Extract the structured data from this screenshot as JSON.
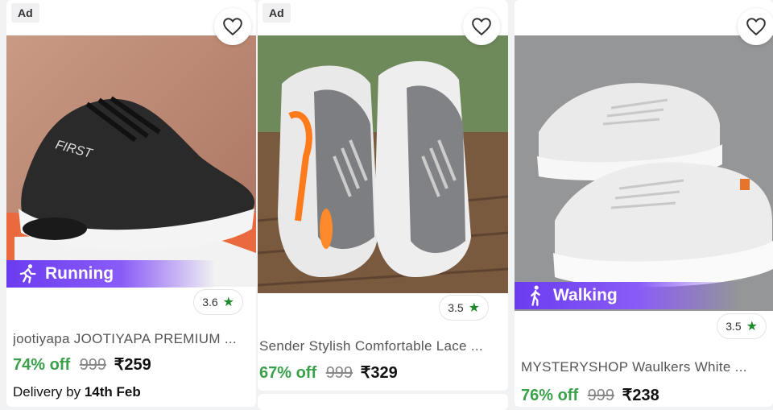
{
  "products": [
    {
      "ad": "Ad",
      "tag": "Running",
      "rating": "3.6",
      "title": "jootiyapa JOOTIYAPA PREMIUM ...",
      "discount": "74% off",
      "mrp": "999",
      "price": "₹259",
      "delivery_prefix": "Delivery by",
      "delivery_date": "14th Feb"
    },
    {
      "ad": "Ad",
      "rating": "3.5",
      "title": "Sender Stylish Comfortable Lace ...",
      "discount": "67% off",
      "mrp": "999",
      "price": "₹329"
    },
    {
      "tag": "Walking",
      "rating": "3.5",
      "title": "MYSTERYSHOP Waulkers White ...",
      "discount": "76% off",
      "mrp": "999",
      "price": "₹238"
    }
  ],
  "icons": {
    "wishlist": "heart-icon",
    "rating": "star-icon",
    "running": "runner-icon",
    "walking": "walker-icon"
  },
  "colors": {
    "discount": "#3aa04a",
    "star": "#1f8a2b",
    "tag": "#6a3cf0"
  }
}
